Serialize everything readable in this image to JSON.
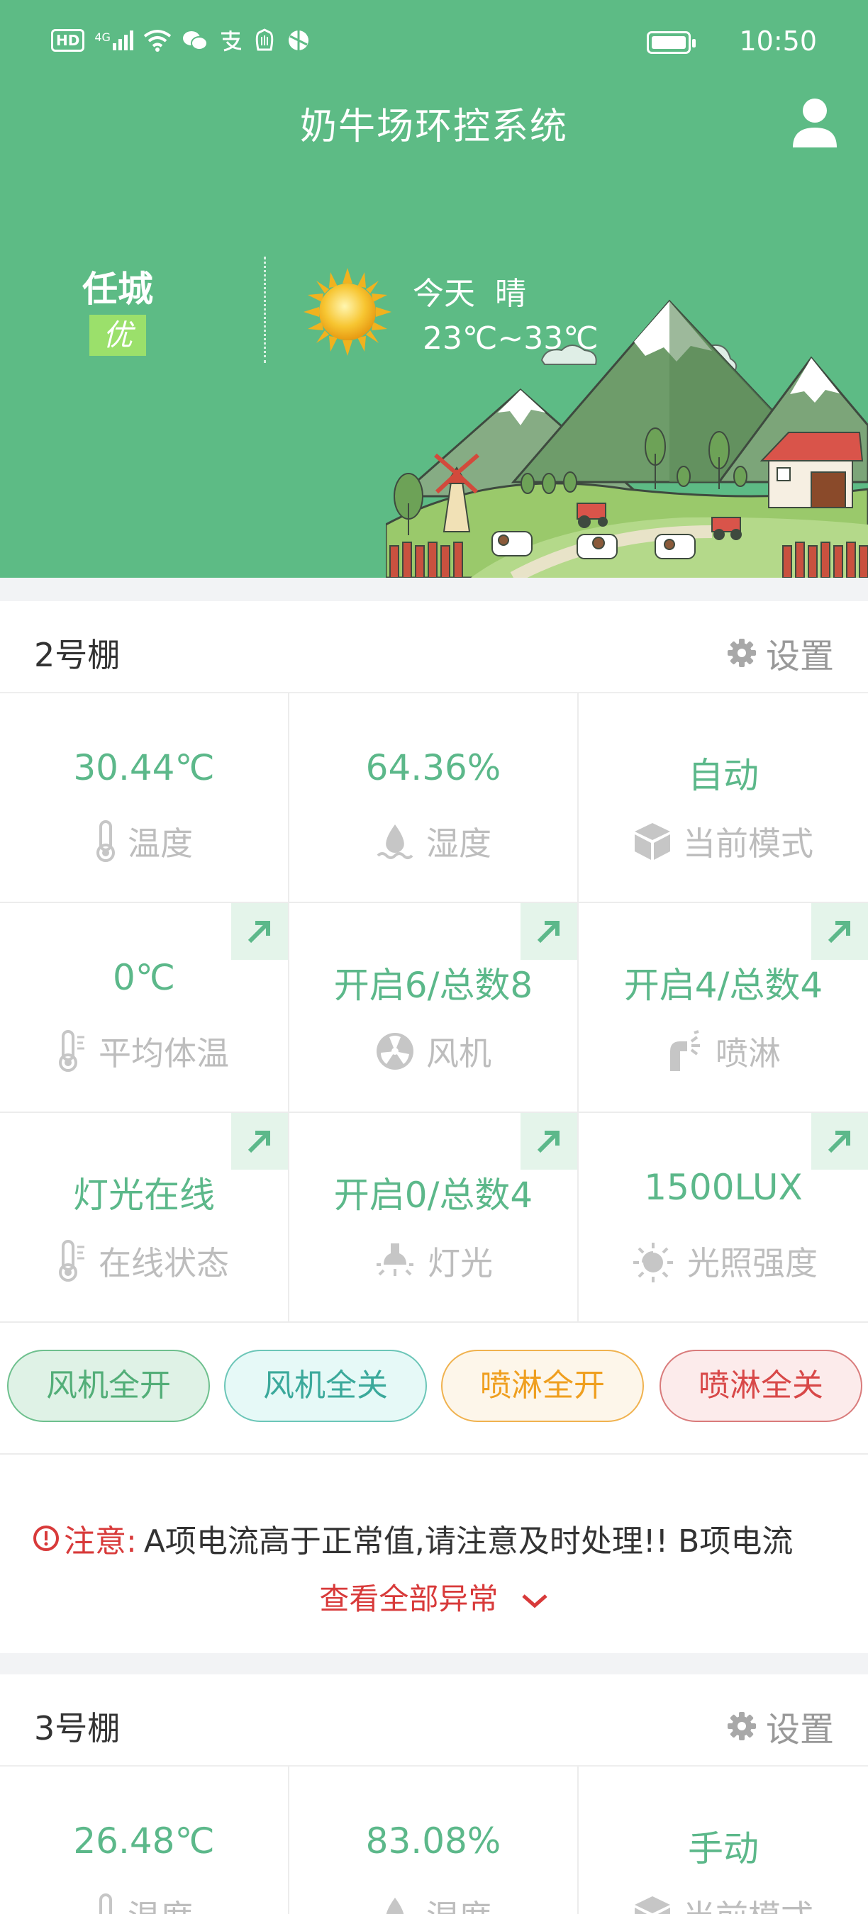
{
  "status": {
    "hd": "HD",
    "net": "4G",
    "time": "10:50"
  },
  "header": {
    "title": "奶牛场环控系统",
    "city": "任城",
    "aqi": "优",
    "weather_day": "今天",
    "weather_cond": "晴",
    "temp_range": "23℃~33℃",
    "accent": "#5dbb85"
  },
  "sheds": [
    {
      "name": "2号棚",
      "settings": "设置",
      "metrics": [
        {
          "value": "30.44℃",
          "label": "温度"
        },
        {
          "value": "64.36%",
          "label": "湿度"
        },
        {
          "value": "自动",
          "label": "当前模式"
        },
        {
          "value": "0℃",
          "label": "平均体温"
        },
        {
          "value": "开启6/总数8",
          "label": "风机"
        },
        {
          "value": "开启4/总数4",
          "label": "喷淋"
        },
        {
          "value": "灯光在线",
          "label": "在线状态"
        },
        {
          "value": "开启0/总数4",
          "label": "灯光"
        },
        {
          "value": "1500LUX",
          "label": "光照强度"
        }
      ],
      "actions": [
        "风机全开",
        "风机全关",
        "喷淋全开",
        "喷淋全关"
      ],
      "alert": {
        "label": "注意:",
        "text": "A项电流高于正常值,请注意及时处理!! B项电流",
        "more": "查看全部异常"
      }
    },
    {
      "name": "3号棚",
      "settings": "设置",
      "metrics": [
        {
          "value": "26.48℃",
          "label": "温度"
        },
        {
          "value": "83.08%",
          "label": "湿度"
        },
        {
          "value": "手动",
          "label": "当前模式"
        }
      ]
    }
  ]
}
